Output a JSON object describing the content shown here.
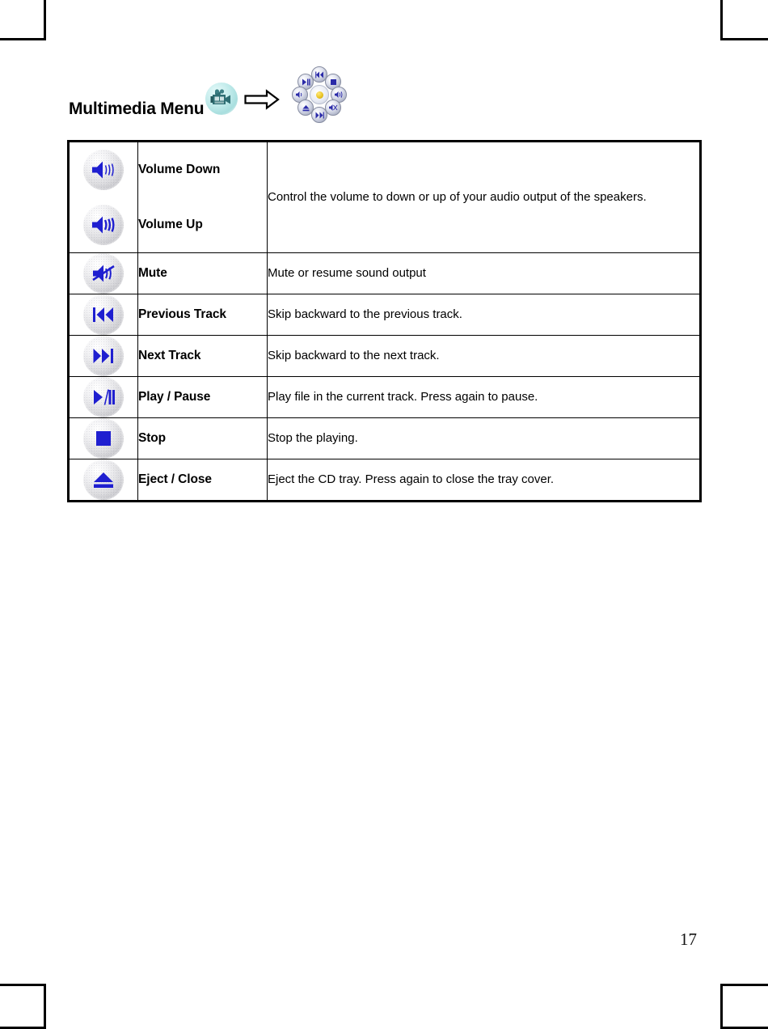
{
  "heading": {
    "title": "Multimedia Menu",
    "source_icon": "camcorder-icon",
    "arrow_icon": "right-arrow-icon",
    "target_icon": "radial-multimedia-menu-icon"
  },
  "table": {
    "rows": [
      {
        "icons": [
          "volume-down-icon",
          "volume-up-icon"
        ],
        "labels": [
          "Volume Down",
          "Volume Up"
        ],
        "description": "Control the volume to down or up of your audio output of the speakers.",
        "justified": true
      },
      {
        "icon": "mute-icon",
        "label": "Mute",
        "description": "Mute or resume sound output",
        "justified": false
      },
      {
        "icon": "previous-track-icon",
        "label": "Previous Track",
        "description": "Skip backward to the previous track.",
        "justified": false
      },
      {
        "icon": "next-track-icon",
        "label": "Next Track",
        "description": "Skip backward to the next track.",
        "justified": false
      },
      {
        "icon": "play-pause-icon",
        "label": "Play / Pause",
        "description": "Play file in the current track. Press again to pause.",
        "justified": false
      },
      {
        "icon": "stop-icon",
        "label": "Stop",
        "description": "Stop the playing.",
        "justified": false
      },
      {
        "icon": "eject-close-icon",
        "label": "Eject / Close",
        "description": "Eject the CD tray. Press again to close the tray cover.",
        "justified": false
      }
    ]
  },
  "footer": {
    "page_number": "17"
  },
  "colors": {
    "icon_glyph": "#1f1fd0",
    "text": "#000000",
    "rule": "#000000",
    "camcorder_bg": "#b9e6e6"
  }
}
